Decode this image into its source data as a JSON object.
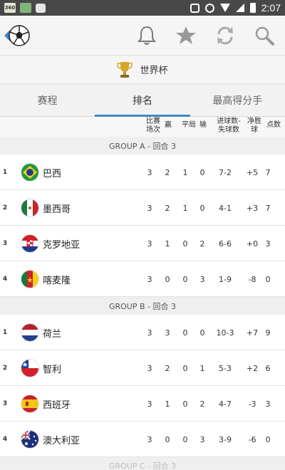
{
  "status_bar": {
    "time": "2:07",
    "app_icon_label": "360"
  },
  "header": {
    "title": "世界杯"
  },
  "tabs": [
    {
      "label": "赛程"
    },
    {
      "label": "排名"
    },
    {
      "label": "最高得分手"
    }
  ],
  "columns": {
    "played": "比赛场次",
    "won": "赢",
    "drawn": "平局",
    "lost": "输",
    "goals": "进球数-失球数",
    "goal_diff": "净胜球",
    "points": "点数"
  },
  "groups": [
    {
      "title": "GROUP A - 回合 3",
      "rows": [
        {
          "rank": "1",
          "team": "巴西",
          "p": "3",
          "w": "2",
          "d": "1",
          "l": "0",
          "g": "7-2",
          "gd": "+5",
          "pts": "7"
        },
        {
          "rank": "2",
          "team": "墨西哥",
          "p": "3",
          "w": "2",
          "d": "1",
          "l": "0",
          "g": "4-1",
          "gd": "+3",
          "pts": "7"
        },
        {
          "rank": "3",
          "team": "克罗地亚",
          "p": "3",
          "w": "1",
          "d": "0",
          "l": "2",
          "g": "6-6",
          "gd": "+0",
          "pts": "3"
        },
        {
          "rank": "4",
          "team": "喀麦隆",
          "p": "3",
          "w": "0",
          "d": "0",
          "l": "3",
          "g": "1-9",
          "gd": "-8",
          "pts": "0"
        }
      ]
    },
    {
      "title": "GROUP B - 回合 3",
      "rows": [
        {
          "rank": "1",
          "team": "荷兰",
          "p": "3",
          "w": "3",
          "d": "0",
          "l": "0",
          "g": "10-3",
          "gd": "+7",
          "pts": "9"
        },
        {
          "rank": "2",
          "team": "智利",
          "p": "3",
          "w": "2",
          "d": "0",
          "l": "1",
          "g": "5-3",
          "gd": "+2",
          "pts": "6"
        },
        {
          "rank": "3",
          "team": "西班牙",
          "p": "3",
          "w": "1",
          "d": "0",
          "l": "2",
          "g": "4-7",
          "gd": "-3",
          "pts": "3"
        },
        {
          "rank": "4",
          "team": "澳大利亚",
          "p": "3",
          "w": "0",
          "d": "0",
          "l": "3",
          "g": "3-9",
          "gd": "-6",
          "pts": "0"
        }
      ]
    }
  ],
  "next_group_peek": "GROUP C - 回合 3",
  "colors": {
    "accent": "#3d87c4",
    "background": "#ececec"
  }
}
